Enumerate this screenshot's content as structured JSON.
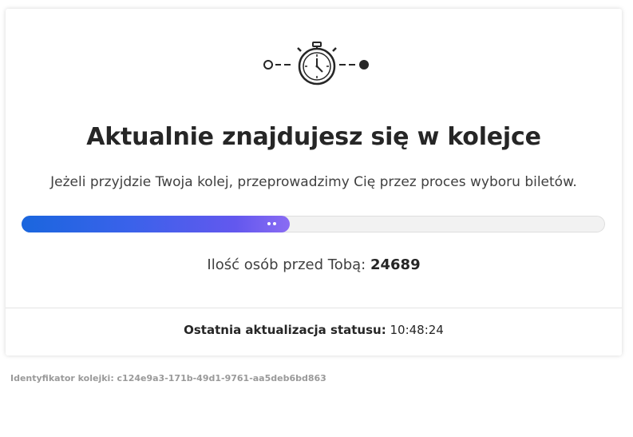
{
  "queue": {
    "title": "Aktualnie znajdujesz się w kolejce",
    "subtitle": "Jeżeli przyjdzie Twoja kolej, przeprowadzimy Cię przez proces wyboru biletów.",
    "progress_fraction": 0.46,
    "people_ahead_label": "Ilość osób przed Tobą:",
    "people_ahead_count": "24689",
    "last_update_label": "Ostatnia aktualizacja statusu:",
    "last_update_time": "10:48:24",
    "queue_id_text": "Identyfikator kolejki: c124e9a3-171b-49d1-9761-aa5deb6bd863"
  },
  "icons": {
    "hero": "stopwatch-icon",
    "start": "hollow-circle-icon",
    "end": "filled-circle-icon"
  },
  "colors": {
    "progress_start": "#1a66de",
    "progress_end": "#8a6cf3",
    "text": "#262626",
    "muted": "#9a9a9a"
  }
}
